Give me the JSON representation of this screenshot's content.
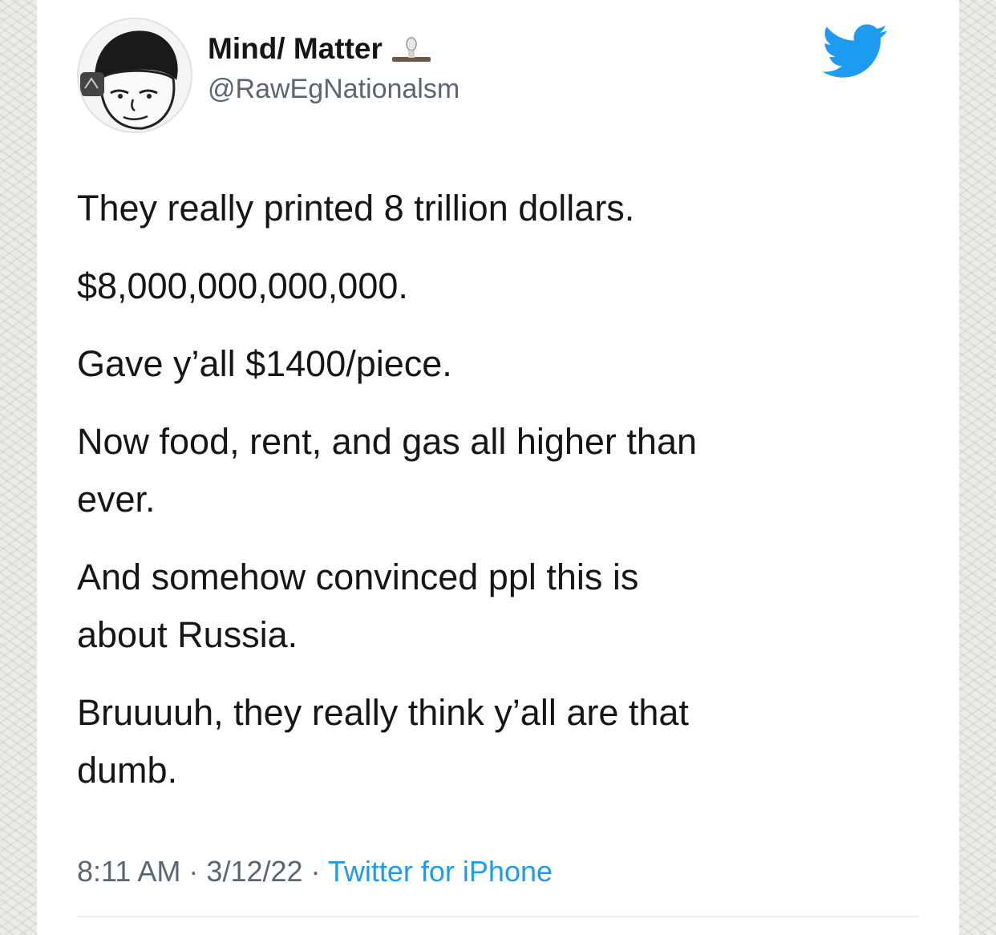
{
  "user": {
    "display_name": "Mind/ Matter",
    "handle": "@RawEgNationalsm",
    "avatar_icon": "wojak-avatar",
    "name_emoji_icon": "egg-emoji-icon"
  },
  "platform_icon": "twitter-bird-icon",
  "brand_color": "#1d9bf0",
  "tweet": {
    "line1": "They really printed 8 trillion dollars.",
    "line2": "$8,000,000,000,000.",
    "line3": "Gave y’all $1400/piece.",
    "line4a": "Now food, rent, and gas all higher than",
    "line4b": "ever.",
    "line5a": "And somehow convinced ppl this is",
    "line5b": "about Russia.",
    "line6a": "Bruuuuh, they really think y’all are that",
    "line6b": "dumb."
  },
  "meta": {
    "time": "8:11 AM",
    "separator": " · ",
    "date": "3/12/22",
    "source": "Twitter for iPhone"
  }
}
